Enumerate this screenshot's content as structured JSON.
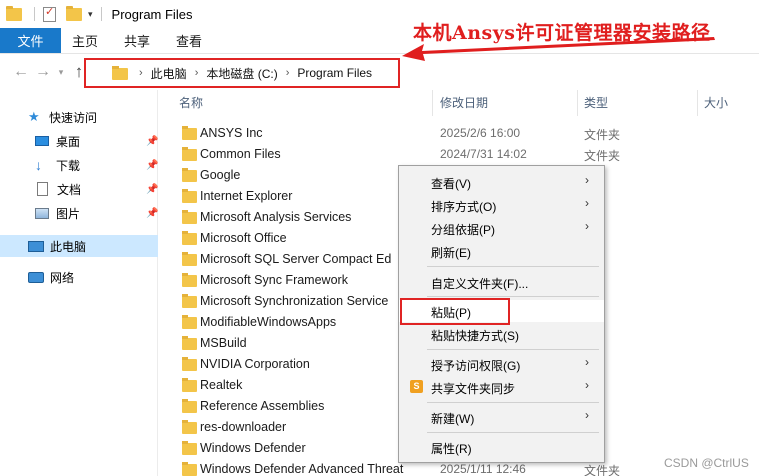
{
  "window": {
    "title": "Program Files"
  },
  "ribbon": {
    "tabs": [
      "文件",
      "主页",
      "共享",
      "查看"
    ]
  },
  "annotation": {
    "text": "本机Ansys许可证管理器安装路径",
    "color": "#e01e1e"
  },
  "address": {
    "crumbs": [
      "此电脑",
      "本地磁盘 (C:)",
      "Program Files"
    ]
  },
  "sidebar": {
    "quick_access": "快速访问",
    "desktop": "桌面",
    "downloads": "下载",
    "documents": "文档",
    "pictures": "图片",
    "this_pc": "此电脑",
    "network": "网络"
  },
  "columns": {
    "name": "名称",
    "date": "修改日期",
    "type": "类型",
    "size": "大小"
  },
  "files": [
    {
      "name": "ANSYS Inc",
      "date": "2025/2/6 16:00",
      "type": "文件夹"
    },
    {
      "name": "Common Files",
      "date": "2024/7/31 14:02",
      "type": "文件夹"
    },
    {
      "name": "Google",
      "date": "",
      "type": ""
    },
    {
      "name": "Internet Explorer",
      "date": "",
      "type": ""
    },
    {
      "name": "Microsoft Analysis Services",
      "date": "",
      "type": ""
    },
    {
      "name": "Microsoft Office",
      "date": "",
      "type": ""
    },
    {
      "name": "Microsoft SQL Server Compact Ed",
      "date": "",
      "type": ""
    },
    {
      "name": "Microsoft Sync Framework",
      "date": "",
      "type": ""
    },
    {
      "name": "Microsoft Synchronization Service",
      "date": "",
      "type": ""
    },
    {
      "name": "ModifiableWindowsApps",
      "date": "",
      "type": ""
    },
    {
      "name": "MSBuild",
      "date": "",
      "type": ""
    },
    {
      "name": "NVIDIA Corporation",
      "date": "",
      "type": ""
    },
    {
      "name": "Realtek",
      "date": "",
      "type": ""
    },
    {
      "name": "Reference Assemblies",
      "date": "",
      "type": ""
    },
    {
      "name": "res-downloader",
      "date": "",
      "type": ""
    },
    {
      "name": "Windows Defender",
      "date": "",
      "type": ""
    },
    {
      "name": "Windows Defender Advanced Threat",
      "date": "2025/1/11 12:46",
      "type": "文件夹"
    }
  ],
  "context_menu": {
    "view": "查看(V)",
    "sort": "排序方式(O)",
    "group": "分组依据(P)",
    "refresh": "刷新(E)",
    "customize": "自定义文件夹(F)...",
    "paste": "粘贴(P)",
    "paste_shortcut": "粘贴快捷方式(S)",
    "give_access": "授予访问权限(G)",
    "share_sync": "共享文件夹同步",
    "new": "新建(W)",
    "properties": "属性(R)"
  },
  "watermark": "CSDN @CtrlUS"
}
